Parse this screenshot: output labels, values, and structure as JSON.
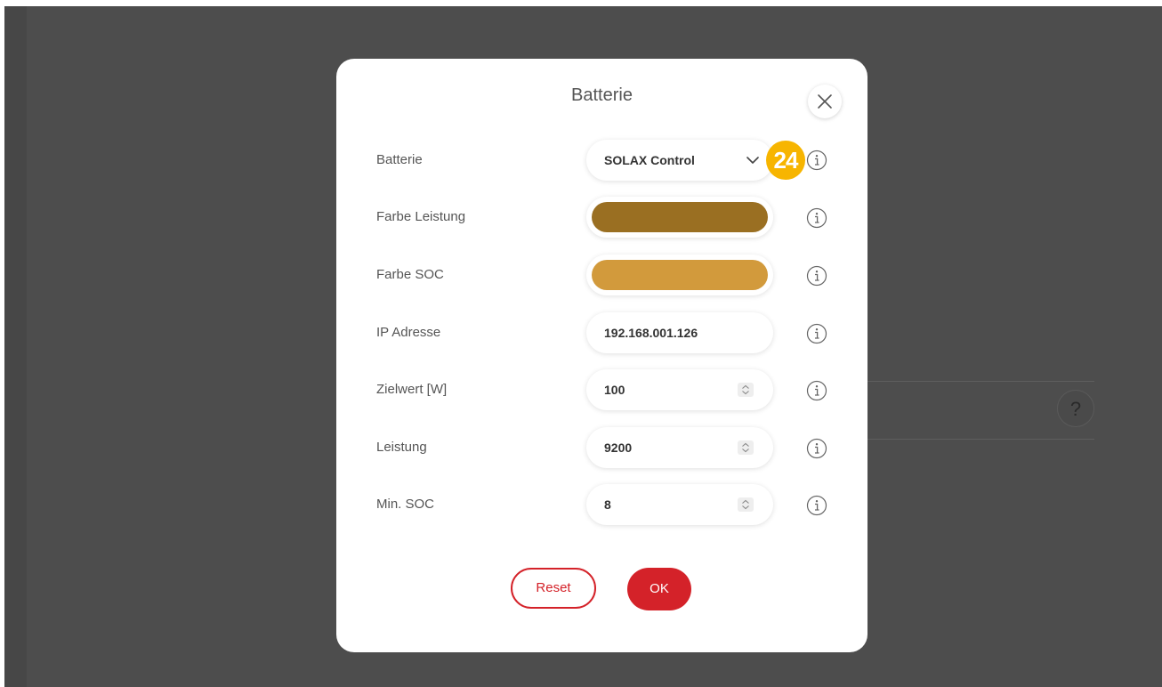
{
  "dialog": {
    "title": "Batterie",
    "close_icon": "close-icon"
  },
  "rows": [
    {
      "label": "Batterie",
      "type": "select",
      "value": "SOLAX Control"
    },
    {
      "label": "Farbe Leistung",
      "type": "color",
      "value": "#9a6f22"
    },
    {
      "label": "Farbe SOC",
      "type": "color",
      "value": "#d29a3c"
    },
    {
      "label": "IP Adresse",
      "type": "text",
      "value": "192.168.001.126"
    },
    {
      "label": "Zielwert [W]",
      "type": "number",
      "value": "100"
    },
    {
      "label": "Leistung",
      "type": "number",
      "value": "9200"
    },
    {
      "label": "Min. SOC",
      "type": "number",
      "value": "8"
    }
  ],
  "badge": {
    "text": "24",
    "color": "#f7b500"
  },
  "buttons": {
    "reset_label": "Reset",
    "ok_label": "OK",
    "accent": "#d42229"
  },
  "background": {
    "help_label": "?"
  }
}
